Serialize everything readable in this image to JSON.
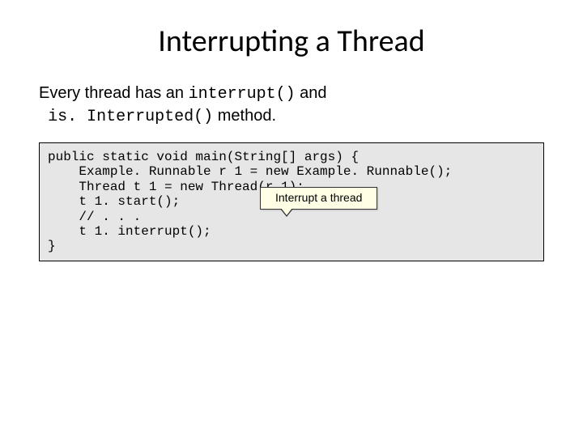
{
  "title": "Interrupting a Thread",
  "intro": {
    "prefix": "Every thread has an ",
    "method1": "interrupt()",
    "mid": " and ",
    "method2": "is. Interrupted()",
    "suffix": " method."
  },
  "code": "public static void main(String[] args) {\n    Example. Runnable r 1 = new Example. Runnable();\n    Thread t 1 = new Thread(r 1);\n    t 1. start();\n    // . . .\n    t 1. interrupt();\n}",
  "callout": "Interrupt a thread"
}
